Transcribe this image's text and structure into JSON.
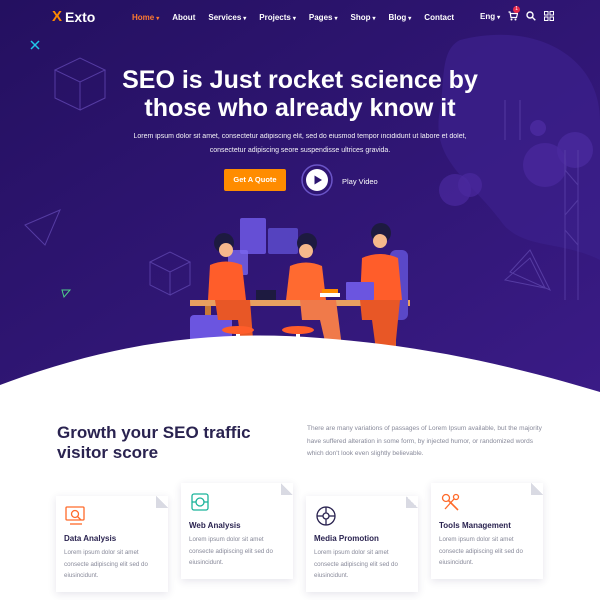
{
  "brand": {
    "mark": "X",
    "name": "Exto"
  },
  "nav": [
    {
      "label": "Home",
      "active": true,
      "dropdown": true
    },
    {
      "label": "About",
      "active": false,
      "dropdown": false
    },
    {
      "label": "Services",
      "active": false,
      "dropdown": true
    },
    {
      "label": "Projects",
      "active": false,
      "dropdown": true
    },
    {
      "label": "Pages",
      "active": false,
      "dropdown": true
    },
    {
      "label": "Shop",
      "active": false,
      "dropdown": true
    },
    {
      "label": "Blog",
      "active": false,
      "dropdown": true
    },
    {
      "label": "Contact",
      "active": false,
      "dropdown": false
    }
  ],
  "header_right": {
    "language": "Eng",
    "cart_count": "1",
    "icons": [
      "cart-icon",
      "search-icon",
      "grid-menu-icon"
    ]
  },
  "hero": {
    "title": "SEO is Just rocket science by those who already know it",
    "subtitle": "Lorem ipsum dolor sit amet, consectetur adipiscing elit, sed do eiusmod tempor incididunt ut labore et dolet, consectetur adipiscing seore suspendisse ultrices gravida.",
    "cta_label": "Get A Quote",
    "play_label": "Play Video"
  },
  "growth": {
    "title": "Growth your SEO traffic visitor score",
    "text": "There are many variations of passages of Lorem Ipsum available, but the majority have suffered alteration in some form, by injected humor, or randomized words which don't look even slightly believable."
  },
  "services": [
    {
      "title": "Data Analysis",
      "text": "Lorem ipsum dolor sit amet consecte adipiscing elit sed do eiusincidunt.",
      "icon": "data-analysis-icon"
    },
    {
      "title": "Web Analysis",
      "text": "Lorem ipsum dolor sit amet consecte adipiscing elit sed do eiusincidunt.",
      "icon": "web-analysis-icon"
    },
    {
      "title": "Media Promotion",
      "text": "Lorem ipsum dolor sit amet consecte adipiscing elit sed do eiusincidunt.",
      "icon": "media-promotion-icon"
    },
    {
      "title": "Tools Management",
      "text": "Lorem ipsum dolor sit amet consecte adipiscing elit sed do eiusincidunt.",
      "icon": "tools-management-icon"
    }
  ],
  "colors": {
    "hero_bg": "#2b1470",
    "accent": "#ff8c00",
    "active_nav": "#ff7a2f",
    "heading": "#2a2350"
  }
}
